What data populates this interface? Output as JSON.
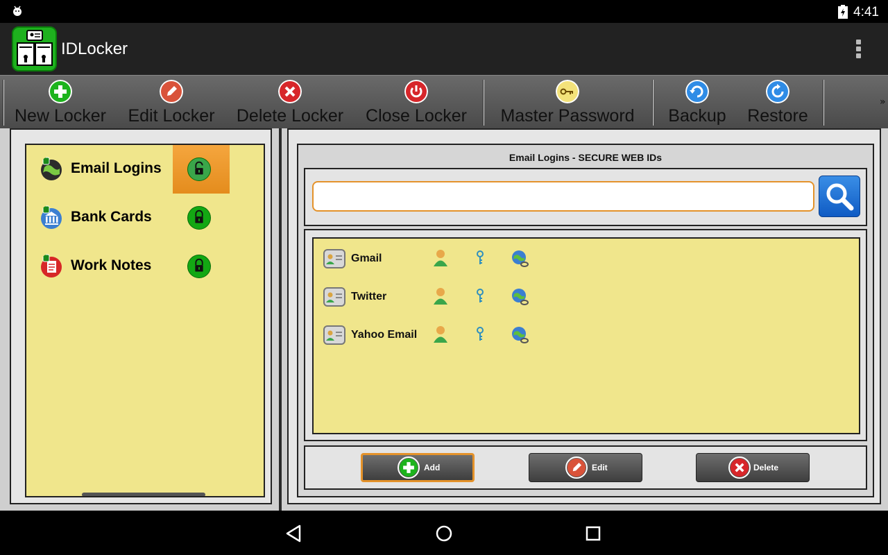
{
  "status_bar": {
    "time": "4:41",
    "icons": [
      "android-debug-icon",
      "battery-charging-icon"
    ]
  },
  "action_bar": {
    "title": "IDLocker",
    "logo_icon": "id-locker-logo-icon",
    "overflow_icon": "overflow-menu-icon"
  },
  "toolbar": {
    "buttons": [
      {
        "label": "New Locker",
        "icon": "plus-icon",
        "color": "#1db31d"
      },
      {
        "label": "Edit Locker",
        "icon": "pencil-icon",
        "color": "#d9533a"
      },
      {
        "label": "Delete Locker",
        "icon": "x-icon",
        "color": "#d7262a"
      },
      {
        "label": "Close Locker",
        "icon": "power-icon",
        "color": "#d7262a"
      },
      {
        "label": "Master Password",
        "icon": "key-icon",
        "color": "#f3e27a"
      },
      {
        "label": "Backup",
        "icon": "backup-icon",
        "color": "#2f8ce6"
      },
      {
        "label": "Restore",
        "icon": "restore-icon",
        "color": "#2f8ce6"
      }
    ],
    "more": "»"
  },
  "lockers": [
    {
      "label": "Email Logins",
      "icon": "globe-lock-icon",
      "selected": true,
      "state": "unlocked"
    },
    {
      "label": "Bank Cards",
      "icon": "bank-lock-icon",
      "selected": false,
      "state": "locked"
    },
    {
      "label": "Work Notes",
      "icon": "notes-lock-icon",
      "selected": false,
      "state": "locked"
    }
  ],
  "detail": {
    "title": "Email Logins - SECURE WEB IDs",
    "search": {
      "value": "",
      "placeholder": ""
    },
    "entries": [
      {
        "name": "Gmail"
      },
      {
        "name": "Twitter"
      },
      {
        "name": "Yahoo Email"
      }
    ],
    "actions": [
      {
        "label": "Add",
        "icon": "plus-icon",
        "color": "#1db31d",
        "focused": true
      },
      {
        "label": "Edit",
        "icon": "pencil-icon",
        "color": "#d9533a",
        "focused": false
      },
      {
        "label": "Delete",
        "icon": "x-icon",
        "color": "#d7262a",
        "focused": false
      }
    ]
  },
  "colors": {
    "panel_yellow": "#f0e68c",
    "selection_orange": "#e48c1d",
    "toolbar_gray": "#5a5a5a"
  },
  "nav_bar": {
    "icons": [
      "back-icon",
      "home-icon",
      "recents-icon"
    ]
  }
}
